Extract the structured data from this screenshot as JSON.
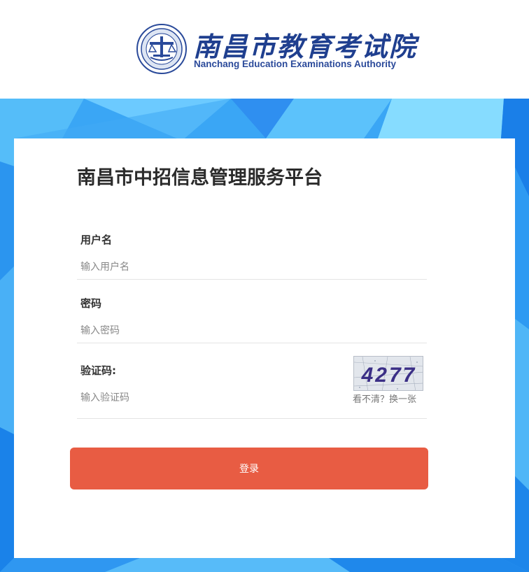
{
  "header": {
    "org_name_cn": "南昌市教育考试院",
    "org_name_en": "Nanchang Education Examinations Authority"
  },
  "login": {
    "title": "南昌市中招信息管理服务平台",
    "username": {
      "label": "用户名",
      "placeholder": "输入用户名",
      "value": ""
    },
    "password": {
      "label": "密码",
      "placeholder": "输入密码",
      "value": ""
    },
    "captcha": {
      "label": "验证码:",
      "placeholder": "输入验证码",
      "value": "",
      "image_text": "4277",
      "refresh_label": "看不清？换一张"
    },
    "submit_label": "登录"
  },
  "colors": {
    "login_button": "#e85c43",
    "background_blue": "#3aa6f5",
    "logo_blue": "#1f3f8f"
  }
}
